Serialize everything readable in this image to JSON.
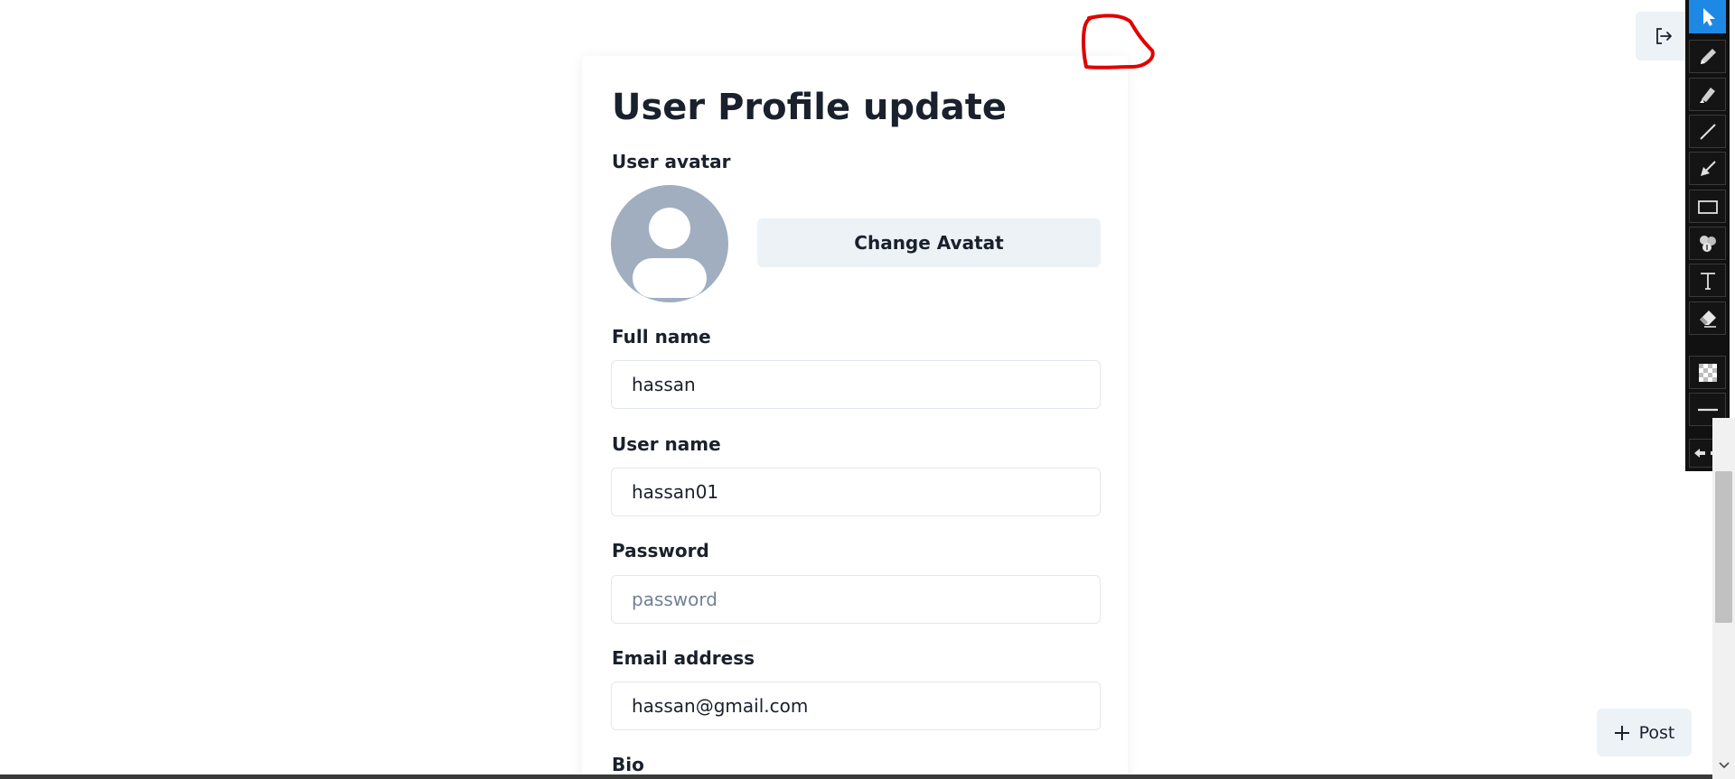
{
  "page": {
    "title": "User Profile update"
  },
  "avatar": {
    "label": "User avatar",
    "change_button": "Change Avatat"
  },
  "fields": {
    "full_name": {
      "label": "Full name",
      "value": "hassan",
      "placeholder": ""
    },
    "user_name": {
      "label": "User name",
      "value": "hassan01",
      "placeholder": ""
    },
    "password": {
      "label": "Password",
      "value": "",
      "placeholder": "password"
    },
    "email": {
      "label": "Email address",
      "value": "hassan@gmail.com",
      "placeholder": ""
    },
    "bio": {
      "label": "Bio"
    }
  },
  "actions": {
    "post_label": "Post",
    "logout_icon": "logout-icon"
  },
  "toolbar": {
    "tools": [
      "select",
      "pencil",
      "marker",
      "line",
      "arrow",
      "rectangle",
      "counter",
      "text",
      "eraser",
      "transparency",
      "stroke-width",
      "move"
    ],
    "active_tool": "select",
    "accent_color": "#1e88e5"
  },
  "annotation": {
    "stroke_color": "#e00000"
  }
}
